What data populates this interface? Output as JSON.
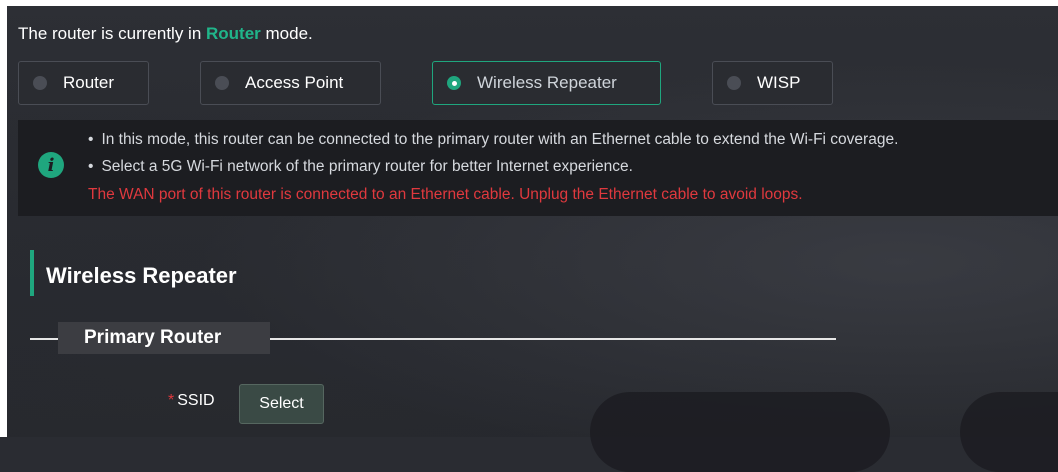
{
  "status": {
    "prefix": "The router is currently in ",
    "mode": "Router",
    "suffix": " mode."
  },
  "modes": [
    {
      "label": "Router",
      "selected": false
    },
    {
      "label": "Access Point",
      "selected": false
    },
    {
      "label": "Wireless Repeater",
      "selected": true
    },
    {
      "label": "WISP",
      "selected": false
    }
  ],
  "info": {
    "icon": "info-icon",
    "bullets": [
      "In this mode, this router can be connected to the primary router with an Ethernet cable to extend the Wi-Fi coverage.",
      "Select a 5G Wi-Fi network of the primary router for better Internet experience."
    ],
    "warning": "The WAN port of this router is connected to an Ethernet cable. Unplug the Ethernet cable to avoid loops."
  },
  "section": {
    "title": "Wireless Repeater",
    "group_label": "Primary Router"
  },
  "ssid": {
    "required_mark": "*",
    "label": "SSID",
    "button_label": "Select"
  },
  "colors": {
    "accent": "#1fa67e",
    "warning": "#e0393e"
  }
}
